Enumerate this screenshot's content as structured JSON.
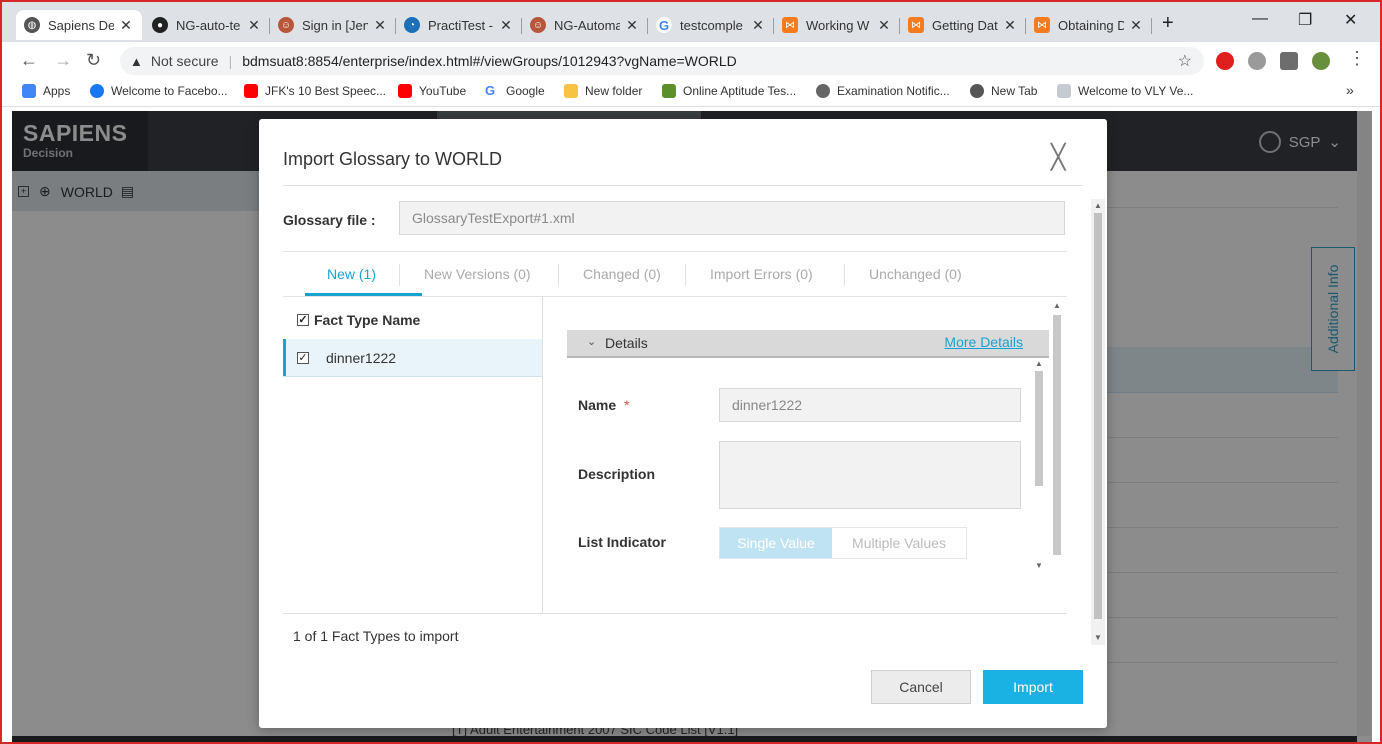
{
  "browser": {
    "tabs": [
      {
        "title": "Sapiens De",
        "icon": "globe-icon",
        "color": "#555555"
      },
      {
        "title": "NG-auto-te",
        "icon": "github-icon",
        "color": "#222222"
      },
      {
        "title": "Sign in [Jen",
        "icon": "jenkins-icon",
        "color": "#b7563a"
      },
      {
        "title": "PractiTest -",
        "icon": "practitest-icon",
        "color": "#1d6fb8"
      },
      {
        "title": "NG-Automa",
        "icon": "jenkins-icon",
        "color": "#b7563a"
      },
      {
        "title": "testcomple",
        "icon": "google-icon",
        "color": "#4285f4"
      },
      {
        "title": "Working W",
        "icon": "smartbear-icon",
        "color": "#f47b20"
      },
      {
        "title": "Getting Dat",
        "icon": "smartbear-icon",
        "color": "#f47b20"
      },
      {
        "title": "Obtaining D",
        "icon": "smartbear-icon",
        "color": "#f47b20"
      }
    ],
    "new_tab": "+",
    "window": {
      "minimize": "—",
      "restore": "❐",
      "close": "✕"
    },
    "address": {
      "security": "Not secure",
      "url": "bdmsuat8:8854/enterprise/index.html#/viewGroups/1012943?vgName=WORLD"
    },
    "bookmarks": [
      {
        "label": "Apps",
        "color": "#4285f4"
      },
      {
        "label": "Welcome to Facebo...",
        "color": "#1877f2"
      },
      {
        "label": "JFK's 10 Best Speec...",
        "color": "#ff0000"
      },
      {
        "label": "YouTube",
        "color": "#ff0000"
      },
      {
        "label": "Google",
        "color": "#4285f4"
      },
      {
        "label": "New folder",
        "color": "#f6c343"
      },
      {
        "label": "Online Aptitude Tes...",
        "color": "#5a8f29"
      },
      {
        "label": "Examination Notific...",
        "color": "#666666"
      },
      {
        "label": "New Tab",
        "color": "#555555"
      },
      {
        "label": "Welcome to VLY Ve...",
        "color": "#9aa0a6"
      }
    ],
    "more": "»"
  },
  "app": {
    "brand": "SAPIENS",
    "brand_sub": "Decision",
    "user": "SGP",
    "tree_root": "WORLD",
    "side_tab": "Additional Info",
    "background_row": "[T]  Adult Entertainment 2007 SIC Code List [V1.1]"
  },
  "modal": {
    "title": "Import Glossary to WORLD",
    "glossary_label": "Glossary file :",
    "glossary_value": "GlossaryTestExport#1.xml",
    "tabs": [
      {
        "label": "New (1)",
        "active": true
      },
      {
        "label": "New Versions (0)",
        "active": false
      },
      {
        "label": "Changed (0)",
        "active": false
      },
      {
        "label": "Import Errors (0)",
        "active": false
      },
      {
        "label": "Unchanged (0)",
        "active": false
      }
    ],
    "list_header": "Fact Type Name",
    "list_items": [
      "dinner1222"
    ],
    "details": {
      "section_title": "Details",
      "more_link": "More Details",
      "name_label": "Name",
      "required_mark": "*",
      "name_value": "dinner1222",
      "description_label": "Description",
      "description_value": "",
      "list_indicator_label": "List Indicator",
      "options": [
        "Single Value",
        "Multiple Values"
      ],
      "selected_option": "Single Value"
    },
    "count_text": "1 of 1 Fact Types to import",
    "cancel_label": "Cancel",
    "import_label": "Import",
    "accent_color": "#1aa3d1"
  }
}
